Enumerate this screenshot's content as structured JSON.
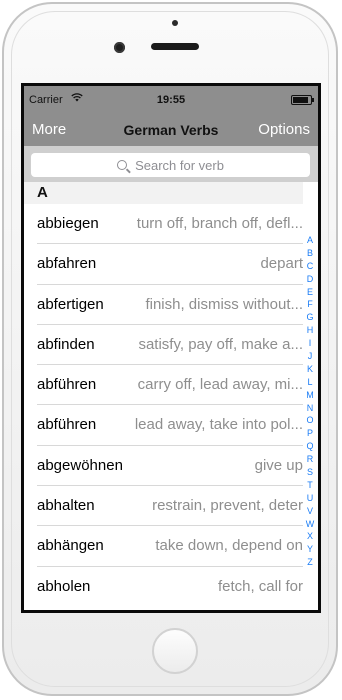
{
  "status_bar": {
    "carrier": "Carrier",
    "wifi_icon": "wifi-icon",
    "time": "19:55",
    "battery_level": 1.0
  },
  "nav": {
    "left": "More",
    "title": "German Verbs",
    "right": "Options"
  },
  "search": {
    "placeholder": "Search for verb"
  },
  "section": "A",
  "rows": [
    {
      "verb": "abbiegen",
      "meaning": "turn off, branch off, defl..."
    },
    {
      "verb": "abfahren",
      "meaning": "depart"
    },
    {
      "verb": "abfertigen",
      "meaning": "finish, dismiss without..."
    },
    {
      "verb": "abfinden",
      "meaning": "satisfy, pay off, make a..."
    },
    {
      "verb": "abführen",
      "meaning": "carry off, lead away, mi..."
    },
    {
      "verb": "abführen",
      "meaning": "lead away, take into pol..."
    },
    {
      "verb": "abgewöhnen",
      "meaning": "give up"
    },
    {
      "verb": "abhalten",
      "meaning": "restrain, prevent, deter"
    },
    {
      "verb": "abhängen",
      "meaning": "take down, depend on"
    },
    {
      "verb": "abholen",
      "meaning": "fetch, call for"
    }
  ],
  "index_letters": [
    "A",
    "B",
    "C",
    "D",
    "E",
    "F",
    "G",
    "H",
    "I",
    "J",
    "K",
    "L",
    "M",
    "N",
    "O",
    "P",
    "Q",
    "R",
    "S",
    "T",
    "U",
    "V",
    "W",
    "X",
    "Y",
    "Z"
  ],
  "colors": {
    "bar": "#8e8e8e",
    "index": "#1a7cf5",
    "muted": "#8e8e8e"
  }
}
